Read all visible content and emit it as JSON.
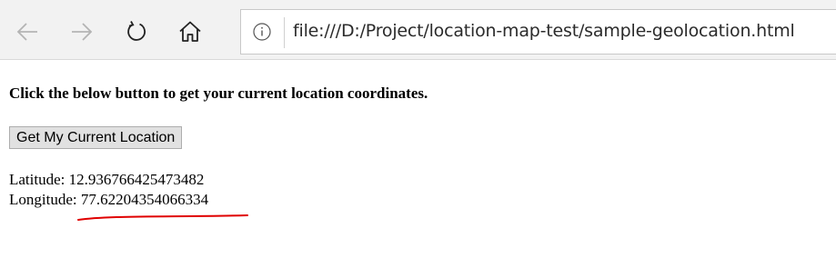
{
  "browser": {
    "back_icon": "arrow-left-icon",
    "forward_icon": "arrow-right-icon",
    "refresh_icon": "refresh-icon",
    "home_icon": "home-icon",
    "info_icon": "info-icon",
    "address": "file:///D:/Project/location-map-test/sample-geolocation.html"
  },
  "page": {
    "heading": "Click the below button to get your current location coordinates.",
    "button_label": "Get My Current Location",
    "latitude_label": "Latitude:",
    "latitude_value": "12.936766425473482",
    "longitude_label": "Longitude:",
    "longitude_value": "77.62204354066334"
  },
  "annotation": {
    "underline_color": "#e00000"
  }
}
